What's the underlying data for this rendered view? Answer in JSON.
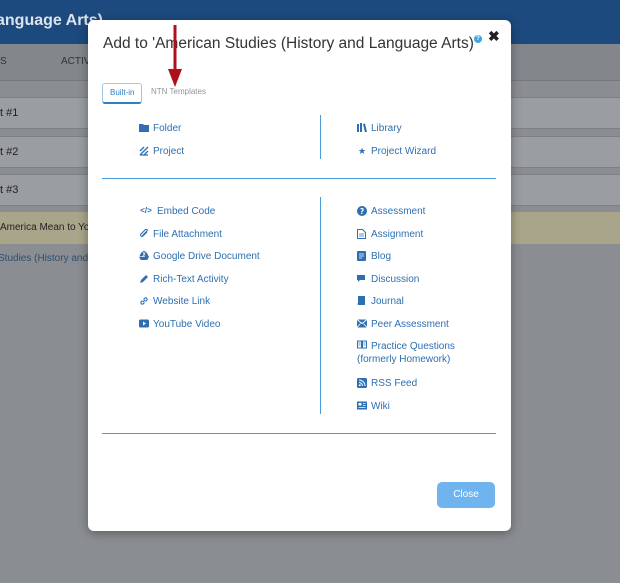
{
  "background": {
    "header_title": "anguage Arts)",
    "tabs": [
      "S",
      "ACTIV"
    ],
    "rows": [
      "t #1",
      "t #2",
      "t #3"
    ],
    "highlight_text": " America Mean to Yo",
    "link_text": "Studies (History and"
  },
  "modal": {
    "title": "Add to 'American Studies (History and Language Arts)'",
    "tabs": [
      {
        "label": "Built-in",
        "active": true
      },
      {
        "label": "NTN Templates",
        "active": false
      }
    ],
    "section1": {
      "left": [
        {
          "label": "Folder",
          "icon": "folder-icon"
        },
        {
          "label": "Project",
          "icon": "project-icon"
        }
      ],
      "right": [
        {
          "label": "Library",
          "icon": "library-icon"
        },
        {
          "label": "Project Wizard",
          "icon": "star-icon"
        }
      ]
    },
    "section2": {
      "left": [
        {
          "label": "Embed Code",
          "icon": "code-icon"
        },
        {
          "label": "File Attachment",
          "icon": "paperclip-icon"
        },
        {
          "label": "Google Drive Document",
          "icon": "google-drive-icon"
        },
        {
          "label": "Rich-Text Activity",
          "icon": "pencil-icon"
        },
        {
          "label": "Website Link",
          "icon": "link-icon"
        },
        {
          "label": "YouTube Video",
          "icon": "youtube-icon"
        }
      ],
      "right": [
        {
          "label": "Assessment",
          "icon": "question-icon"
        },
        {
          "label": "Assignment",
          "icon": "document-icon"
        },
        {
          "label": "Blog",
          "icon": "blog-icon"
        },
        {
          "label": "Discussion",
          "icon": "discussion-icon"
        },
        {
          "label": "Journal",
          "icon": "journal-icon"
        },
        {
          "label": "Peer Assessment",
          "icon": "peer-assessment-icon"
        },
        {
          "label": "Practice Questions (formerly Homework)",
          "icon": "practice-questions-icon"
        },
        {
          "label": "RSS Feed",
          "icon": "rss-icon"
        },
        {
          "label": "Wiki",
          "icon": "wiki-icon"
        }
      ]
    },
    "close_label": "Close"
  },
  "colors": {
    "accent": "#2d6fb0",
    "divider": "#4a9bd8",
    "close_button": "#6fb3ef",
    "annotation_arrow": "#b0101c"
  }
}
